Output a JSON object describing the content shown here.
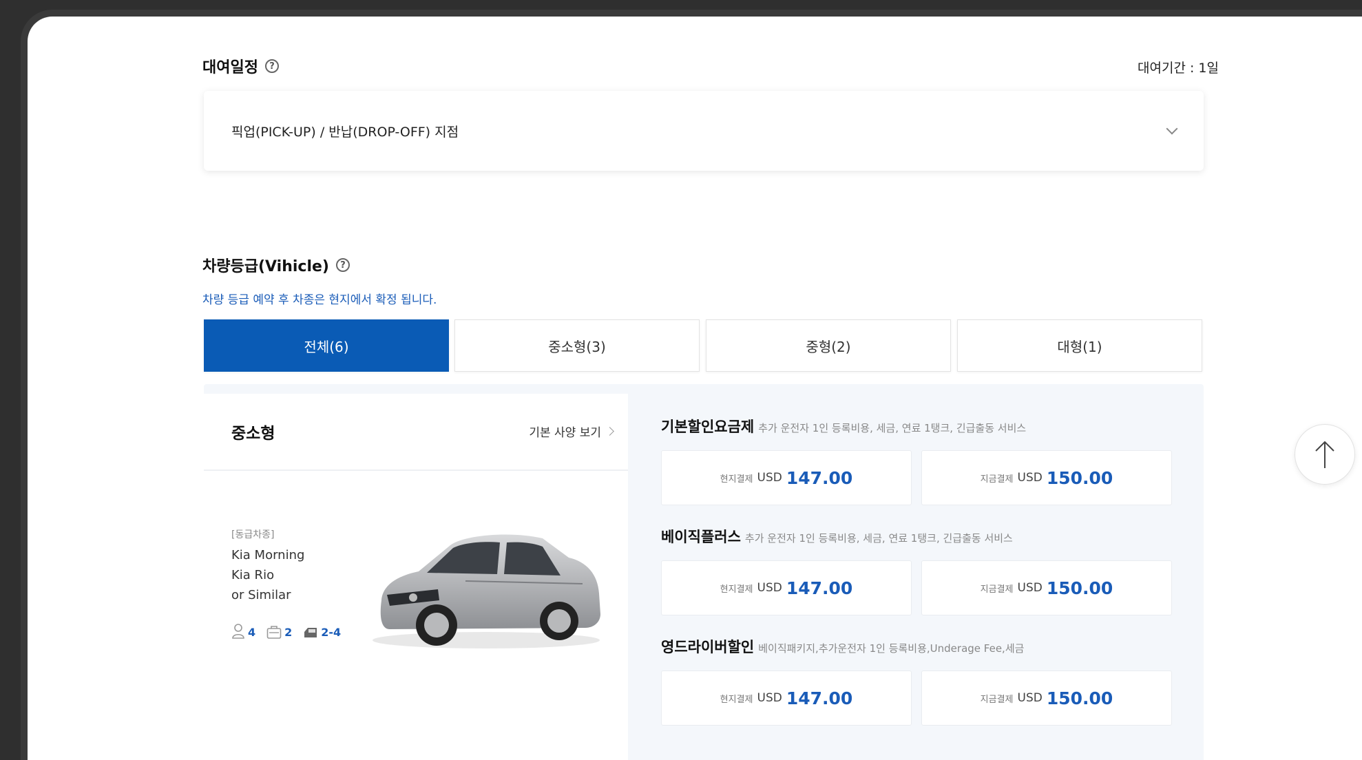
{
  "schedule": {
    "title": "대여일정",
    "period": "대여기간 : 1일",
    "location": "픽업(PICK-UP) / 반납(DROP-OFF) 지점"
  },
  "vehicle": {
    "title": "차량등급(Vihicle)",
    "notice": "차량 등급 예약 후 차종은 현지에서 확정 됩니다.",
    "tabs": [
      {
        "label": "전체(6)",
        "active": true
      },
      {
        "label": "중소형(3)",
        "active": false
      },
      {
        "label": "중형(2)",
        "active": false
      },
      {
        "label": "대형(1)",
        "active": false
      }
    ]
  },
  "car": {
    "class_name": "중소형",
    "spec_link": "기본 사양 보기",
    "grade_label": "[동급차종]",
    "models": [
      "Kia Morning",
      "Kia Rio",
      "or Similar"
    ],
    "seats": "4",
    "bags": "2",
    "doors": "2-4"
  },
  "plans": [
    {
      "name": "기본할인요금제",
      "desc": "추가 운전자 1인 등록비용, 세금, 연료 1탱크, 긴급출동 서비스",
      "local": {
        "label": "현지결제",
        "currency": "USD",
        "amount": "147.00"
      },
      "now": {
        "label": "지금결제",
        "currency": "USD",
        "amount": "150.00"
      }
    },
    {
      "name": "베이직플러스",
      "desc": "추가 운전자 1인 등록비용, 세금, 연료 1탱크, 긴급출동 서비스",
      "local": {
        "label": "현지결제",
        "currency": "USD",
        "amount": "147.00"
      },
      "now": {
        "label": "지금결제",
        "currency": "USD",
        "amount": "150.00"
      }
    },
    {
      "name": "영드라이버할인",
      "desc": "베이직패키지,추가운전자 1인 등록비용,Underage Fee,세금",
      "local": {
        "label": "현지결제",
        "currency": "USD",
        "amount": "147.00"
      },
      "now": {
        "label": "지금결제",
        "currency": "USD",
        "amount": "150.00"
      }
    }
  ],
  "colors": {
    "accent": "#0a5bb5",
    "price": "#1a5cb8"
  }
}
